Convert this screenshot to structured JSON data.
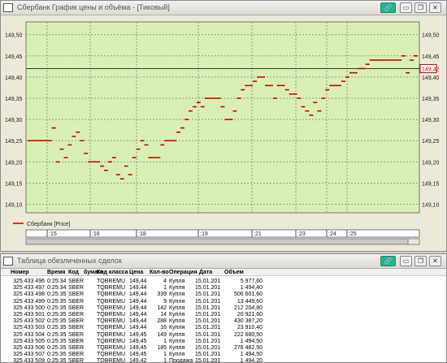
{
  "chart_window": {
    "title": "Сбербанк График цены и объёма - [Тиковый]",
    "buttons": {
      "link": "🔗",
      "minimize": "▭",
      "restore": "❐",
      "close": "✕"
    }
  },
  "table_window": {
    "title": "Таблица обезличенных сделок",
    "buttons": {
      "link": "🔗",
      "minimize": "▭",
      "restore": "❐",
      "close": "✕"
    }
  },
  "chart_data": {
    "type": "line",
    "title": "",
    "series": [
      {
        "name": "Сбербанк [Price]",
        "color": "#cc0000"
      }
    ],
    "y_ticks": [
      "149,10",
      "149,15",
      "149,20",
      "149,25",
      "149,30",
      "149,35",
      "149,40",
      "149,45",
      "149,50"
    ],
    "ylim": [
      149.08,
      149.53
    ],
    "current_price_label": "149,42",
    "current_price": 149.42,
    "x_ticks": [
      ":15",
      ":16",
      ":18",
      ":19",
      ":21",
      ":23",
      ":24",
      ":25"
    ],
    "grid": true,
    "steps": [
      [
        149.25,
        149.25,
        149.25,
        149.25,
        149.25,
        149.25
      ],
      [
        149.28,
        149.2,
        149.23,
        149.21,
        149.24,
        149.26,
        149.27,
        149.25
      ],
      [
        149.22,
        149.2,
        149.2,
        149.2,
        149.19,
        149.18,
        149.2,
        149.21,
        149.17,
        149.16
      ],
      [
        149.19,
        149.17,
        149.21,
        149.23,
        149.25,
        149.24,
        149.21,
        149.21,
        149.21,
        149.24
      ],
      [
        149.25,
        149.25,
        149.25,
        149.27,
        149.28,
        149.3,
        149.32,
        149.33,
        149.34,
        149.33
      ],
      [
        149.35,
        149.35,
        149.35,
        149.35,
        149.33,
        149.3,
        149.3,
        149.32,
        149.35,
        149.37
      ],
      [
        149.38,
        149.38,
        149.39,
        149.4,
        149.4,
        149.38,
        149.38,
        149.35,
        149.38,
        149.38,
        149.37
      ],
      [
        149.36,
        149.36,
        149.35,
        149.33,
        149.32,
        149.31,
        149.34,
        149.32,
        149.35,
        149.37,
        149.38
      ],
      [
        149.38,
        149.38,
        149.39,
        149.4,
        149.41,
        149.41,
        149.42,
        149.42,
        149.43,
        149.44
      ],
      [
        149.44,
        149.44,
        149.44,
        149.44,
        149.44,
        149.44,
        149.44,
        149.45,
        149.41,
        149.44,
        149.45
      ]
    ]
  },
  "table": {
    "columns": [
      "Номер",
      "Время",
      "Код",
      "бумаги",
      "Код класса",
      "Цена",
      "Кол-во",
      "Операция",
      "Дата",
      "Объем"
    ],
    "rows": [
      [
        "325 433 496",
        "0:25:34",
        "SBER",
        "TQBREMU",
        "149,44",
        "4",
        "Купля",
        "15.01.201",
        "5 977,60"
      ],
      [
        "325 433 497",
        "0:25:34",
        "SBER",
        "TQBREMU",
        "149,44",
        "1",
        "Купля",
        "15.01.201",
        "1 494,40"
      ],
      [
        "325 433 498",
        "0:25:35",
        "SBER",
        "TQBREMU",
        "149,44",
        "339",
        "Купля",
        "15.01.201",
        "506 601,60"
      ],
      [
        "325 433 499",
        "0:25:35",
        "SBER",
        "TQBREMU",
        "149,44",
        "9",
        "Купля",
        "15.01.201",
        "13 449,60"
      ],
      [
        "325 433 500",
        "0:25:35",
        "SBER",
        "TQBREMU",
        "149,44",
        "142",
        "Купля",
        "15.01.201",
        "212 204,80"
      ],
      [
        "325 433 501",
        "0:25:35",
        "SBER",
        "TQBREMU",
        "149,44",
        "14",
        "Купля",
        "15.01.201",
        "20 921,60"
      ],
      [
        "325 433 502",
        "0:25:35",
        "SBER",
        "TQBREMU",
        "149,44",
        "288",
        "Купля",
        "15.01.201",
        "430 387,20"
      ],
      [
        "325 433 503",
        "0:25:35",
        "SBER",
        "TQBREMU",
        "149,44",
        "16",
        "Купля",
        "15.01.201",
        "23 910,40"
      ],
      [
        "325 433 504",
        "0:25:35",
        "SBER",
        "TQBREMU",
        "149,45",
        "149",
        "Купля",
        "15.01.201",
        "222 680,50"
      ],
      [
        "325 433 505",
        "0:25:35",
        "SBER",
        "TQBREMU",
        "149,45",
        "1",
        "Купля",
        "15.01.201",
        "1 494,50"
      ],
      [
        "325 433 506",
        "0:25:35",
        "SBER",
        "TQBREMU",
        "149,45",
        "185",
        "Купля",
        "15.01.201",
        "276 482,50"
      ],
      [
        "325 433 507",
        "0:25:35",
        "SBER",
        "TQBREMU",
        "149,45",
        "1",
        "Купля",
        "15.01.201",
        "1 494,50"
      ],
      [
        "325 433 509",
        "0:25:35",
        "SBER",
        "TQBREMU",
        "149,42",
        "1",
        "Продажа",
        "15.01.201",
        "1 494,20"
      ]
    ]
  }
}
